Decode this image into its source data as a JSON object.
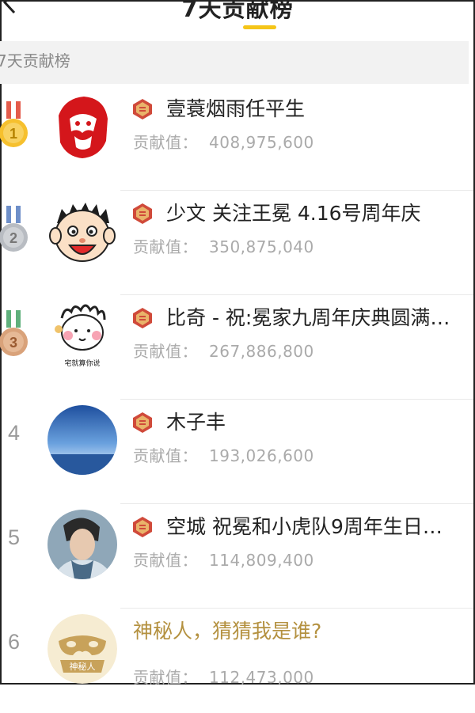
{
  "header": {
    "title": "7天贡献榜",
    "back_icon": "chevron-left-icon"
  },
  "section": {
    "label": "7天贡献榜"
  },
  "colors": {
    "accent": "#f5c518",
    "level_badge": "#d04a3a",
    "mystery_gold": "#b49140"
  },
  "list": [
    {
      "rank": "1",
      "medal": "gold",
      "name": "壹蓑烟雨任平生",
      "contrib_label": "贡献值：",
      "value": "408,975,600"
    },
    {
      "rank": "2",
      "medal": "silver",
      "name": "少文 关注王冕 4.16号周年庆",
      "contrib_label": "贡献值：",
      "value": "350,875,040"
    },
    {
      "rank": "3",
      "medal": "bronze",
      "name": "比奇 - 祝:冕家九周年庆典圆满…",
      "contrib_label": "贡献值：",
      "value": "267,886,800",
      "avatar_caption": "宅就算你说"
    },
    {
      "rank": "4",
      "name": "木子丰",
      "contrib_label": "贡献值：",
      "value": "193,026,600"
    },
    {
      "rank": "5",
      "name": "空城 祝冕和小虎队9周年生日…",
      "contrib_label": "贡献值：",
      "value": "114,809,400"
    },
    {
      "rank": "6",
      "name": "神秘人，猜猜我是谁?",
      "contrib_label": "贡献值：",
      "value": "112,473,000",
      "avatar_caption": "神秘人"
    }
  ]
}
